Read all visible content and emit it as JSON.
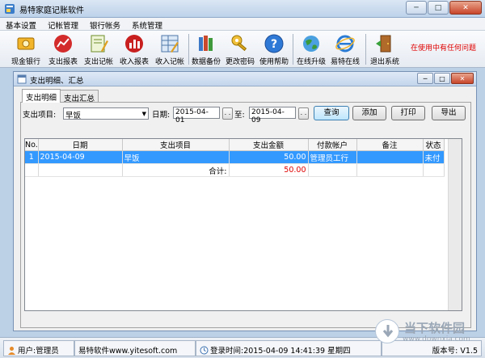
{
  "window": {
    "title": "易特家庭记账软件"
  },
  "menu": [
    "基本设置",
    "记帐管理",
    "银行帐务",
    "系统管理"
  ],
  "toolbar": {
    "buttons": [
      "现金银行",
      "支出报表",
      "支出记帐",
      "收入报表",
      "收入记帐",
      "数据备份",
      "更改密码",
      "使用帮助",
      "在线升级",
      "易特在线",
      "退出系统"
    ],
    "status_text": "在使用中有任何问题"
  },
  "child": {
    "title": "支出明细、汇总",
    "tabs": [
      "支出明细",
      "支出汇总"
    ],
    "filter": {
      "item_label": "支出项目:",
      "item_value": "早饭",
      "date_label": "日期:",
      "date_from": "2015-04-01",
      "to_label": "至:",
      "date_to": "2015-04-09",
      "dots": ". ."
    },
    "buttons": {
      "query": "查询",
      "add": "添加",
      "print": "打印",
      "export": "导出"
    },
    "grid": {
      "headers": [
        "No.",
        "日期",
        "支出项目",
        "支出金额",
        "付款帐户",
        "备注",
        "状态"
      ],
      "rows": [
        {
          "no": "1",
          "date": "2015-04-09",
          "item": "早饭",
          "amount": "50.00",
          "account": "管理员工行",
          "note": "",
          "status": "未付"
        }
      ],
      "total_label": "合计:",
      "total_value": "50.00"
    }
  },
  "statusbar": {
    "user": "用户:管理员",
    "site": "易特软件www.yitesoft.com",
    "login": "登录时间:2015-04-09 14:41:39 星期四",
    "version": "版本号: V1.5"
  },
  "watermark": {
    "text1": "当下软件园",
    "text2": "www.downxia.com"
  },
  "colors": {
    "selection": "#3399ff",
    "amount_red": "#e00000",
    "status_red": "#e00000"
  }
}
